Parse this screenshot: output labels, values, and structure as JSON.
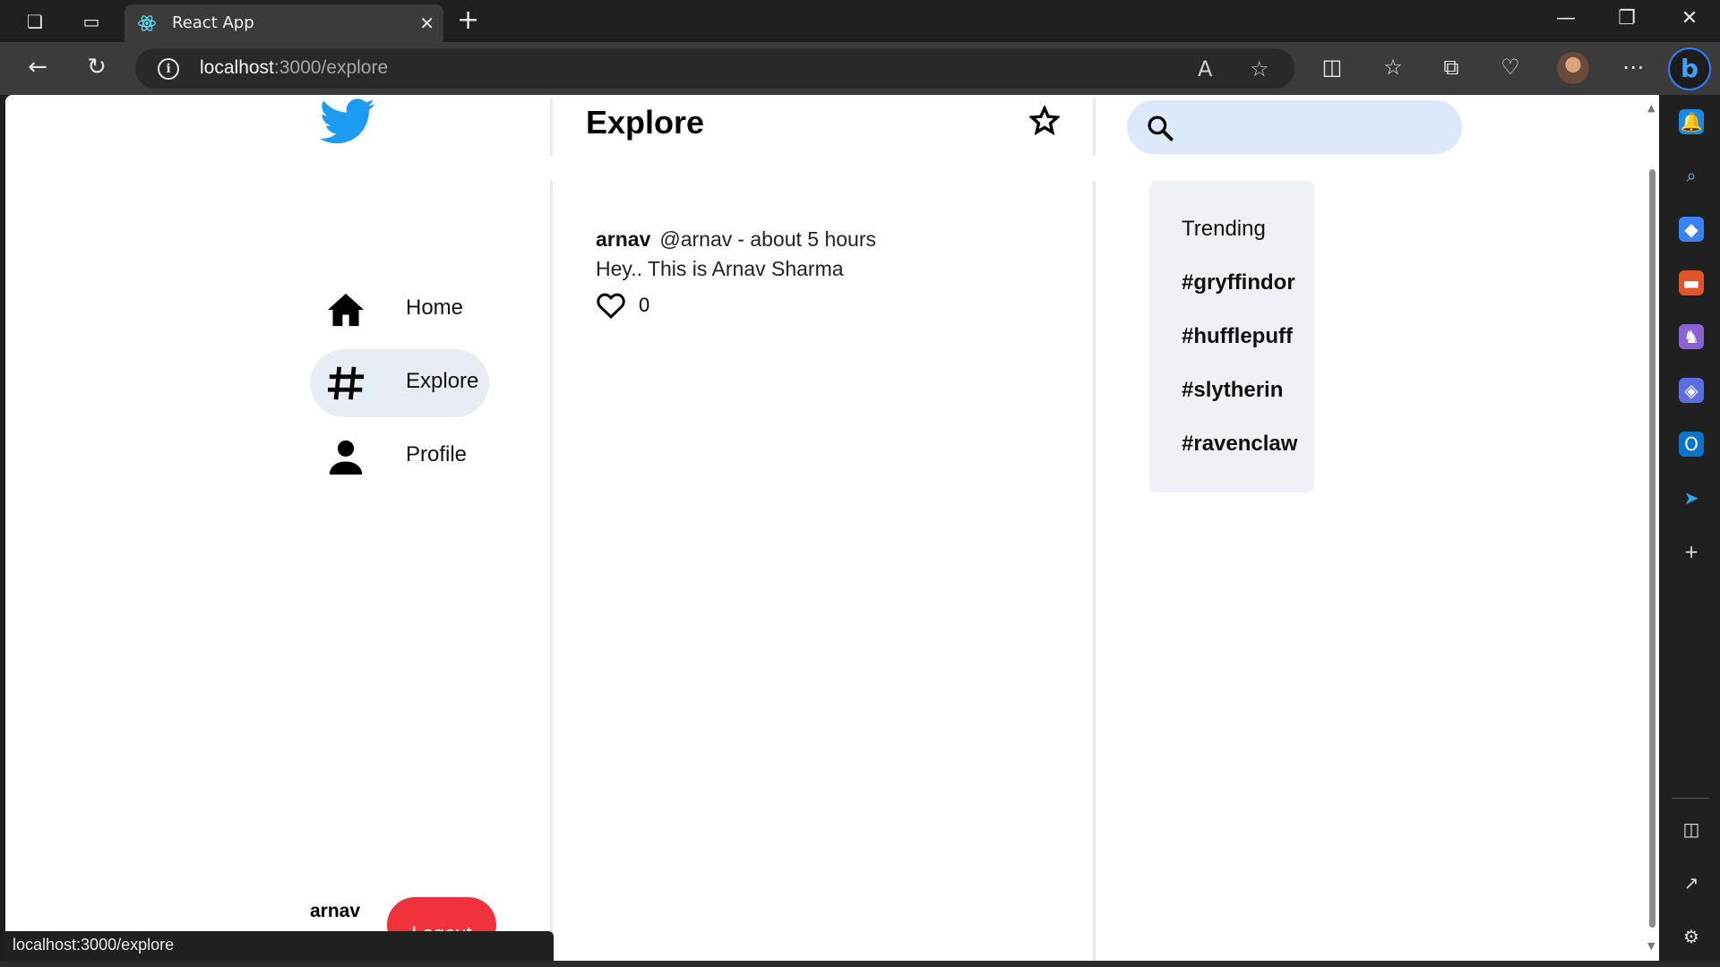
{
  "browser": {
    "tab_title": "React App",
    "url_host": "localhost",
    "url_path": ":3000/explore",
    "status_url": "localhost:3000/explore"
  },
  "nav": {
    "items": [
      {
        "label": "Home",
        "icon": "home-icon"
      },
      {
        "label": "Explore",
        "icon": "hashtag-icon",
        "active": true
      },
      {
        "label": "Profile",
        "icon": "person-icon"
      }
    ],
    "username": "arnav",
    "logout_label": "Logout"
  },
  "main": {
    "title": "Explore",
    "tweets": [
      {
        "author": "arnav",
        "handle": "@arnav",
        "time": "- about 5 hours",
        "text": "Hey.. This is Arnav Sharma",
        "likes": "0"
      }
    ]
  },
  "search": {
    "placeholder": ""
  },
  "trending": {
    "title": "Trending",
    "tags": [
      "#gryffindor",
      "#hufflepuff",
      "#slytherin",
      "#ravenclaw"
    ]
  },
  "colors": {
    "twitter_blue": "#1d9bf0",
    "logout_red": "#f0323c",
    "search_bg": "#dde9fb",
    "active_nav_bg": "#e8edf4"
  }
}
